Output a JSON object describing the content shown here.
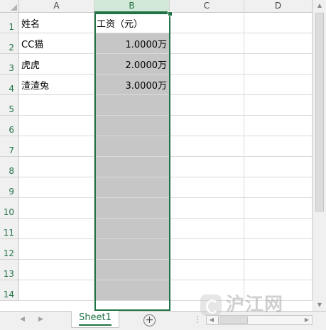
{
  "columns": [
    "A",
    "B",
    "C",
    "D"
  ],
  "rows": [
    "1",
    "2",
    "3",
    "4",
    "5",
    "6",
    "7",
    "8",
    "9",
    "10",
    "11",
    "12",
    "13",
    "14"
  ],
  "cells": {
    "A1": "姓名",
    "B1": "工资（元）",
    "A2": "CC猫",
    "B2": "1.0000万",
    "A3": "虎虎",
    "B3": "2.0000万",
    "A4": "渣渣兔",
    "B4": "3.0000万"
  },
  "selected_column": "B",
  "sheet_tab": "Sheet1",
  "add_sheet_icon": "plus-circle-icon",
  "watermark": {
    "icon": "hujiang-logo-icon",
    "text": "沪江网"
  },
  "colors": {
    "accent": "#217346",
    "selection_fill": "#c6c6c6",
    "header_selected": "#d2e9d9"
  }
}
